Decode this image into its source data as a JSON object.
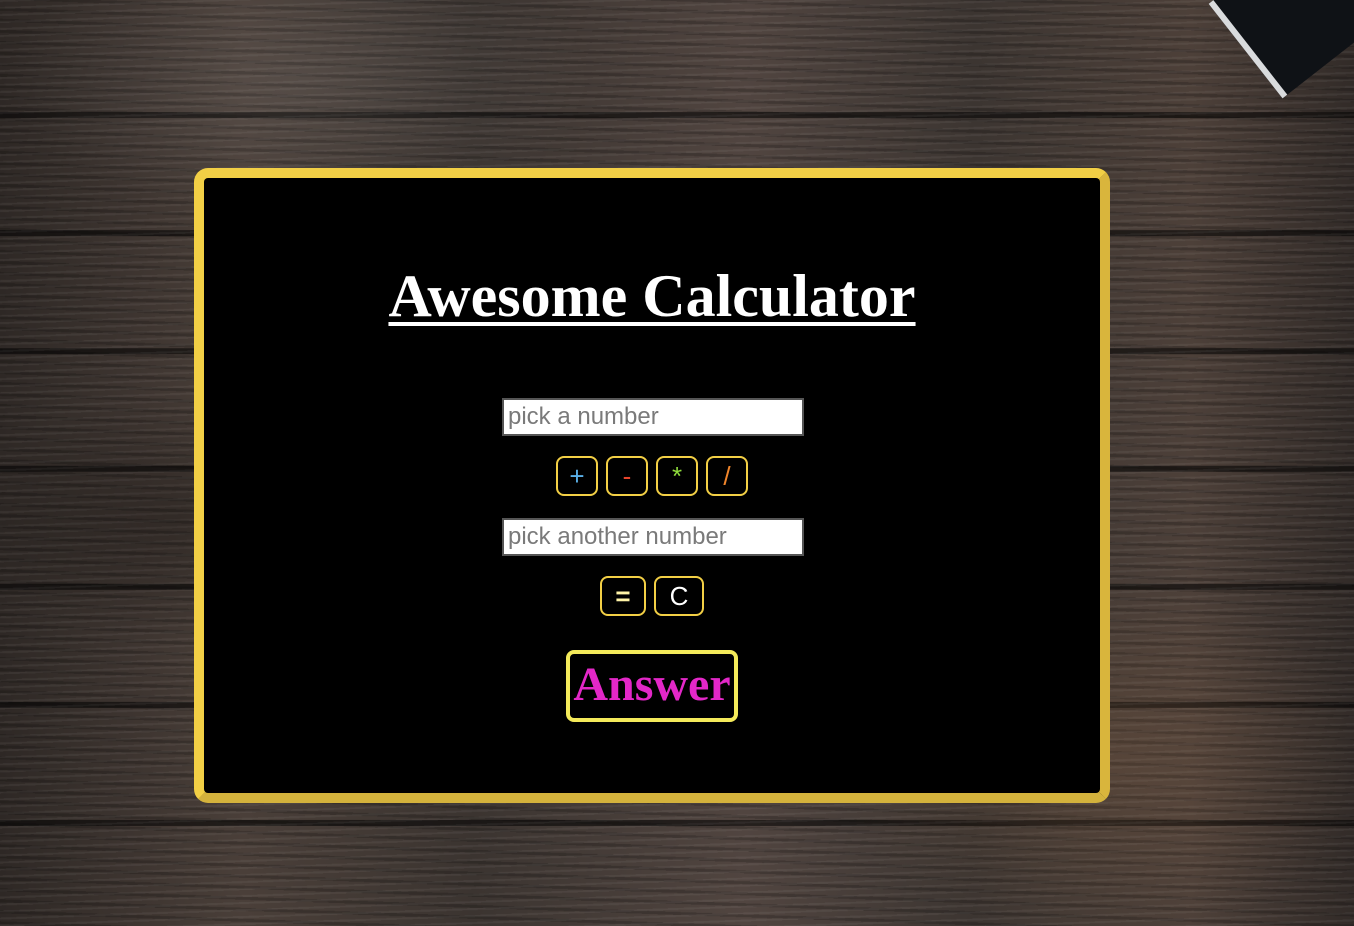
{
  "app": {
    "title": "Awesome Calculator"
  },
  "inputs": {
    "first_placeholder": "pick a number",
    "first_value": "",
    "second_placeholder": "pick another number",
    "second_value": ""
  },
  "operators": [
    {
      "label": "+",
      "icon": "plus-icon",
      "color": "#5ab0e8"
    },
    {
      "label": "-",
      "icon": "minus-icon",
      "color": "#e8452c"
    },
    {
      "label": "*",
      "icon": "multiply-icon",
      "color": "#8fdc3c"
    },
    {
      "label": "/",
      "icon": "divide-icon",
      "color": "#f0852b"
    }
  ],
  "actions": {
    "equals_label": "=",
    "equals_color": "#fff4a8",
    "clear_label": "C",
    "clear_color": "#ffffff"
  },
  "result": {
    "label": "Answer",
    "color": "#e327c8"
  },
  "theme": {
    "card_border": "#f2cf45",
    "card_background": "#000000",
    "answer_border": "#f4ea5a"
  }
}
